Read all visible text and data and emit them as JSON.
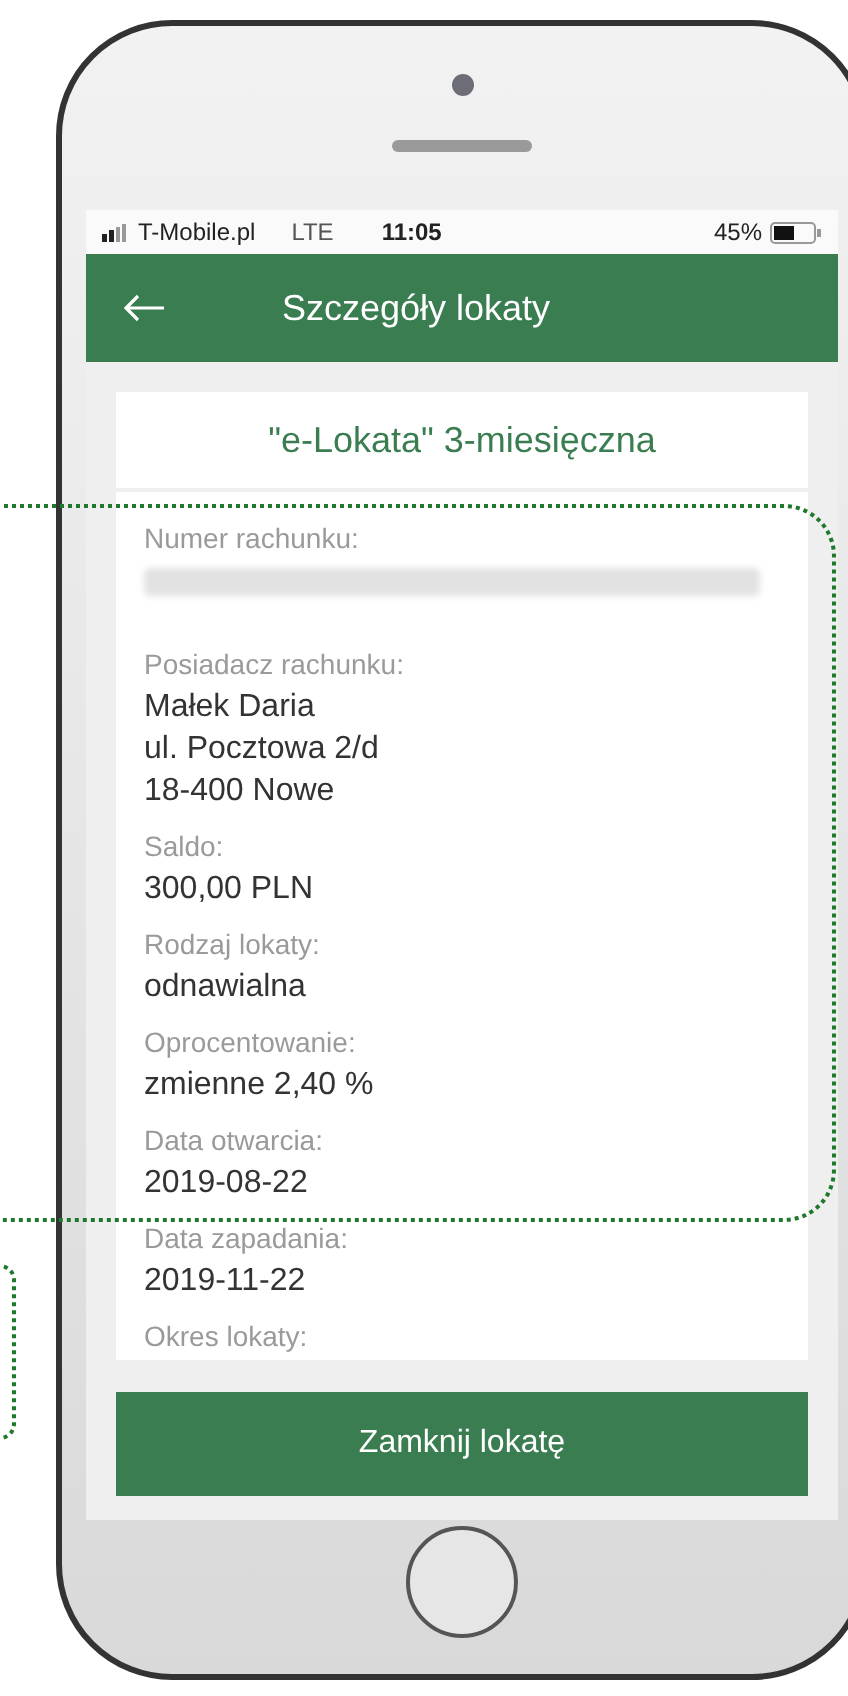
{
  "status_bar": {
    "carrier": "T-Mobile.pl",
    "network": "LTE",
    "time": "11:05",
    "battery": "45%"
  },
  "header": {
    "title": "Szczegóły lokaty"
  },
  "deposit_title": "\"e-Lokata\" 3-miesięczna",
  "fields": [
    {
      "kind": "masked",
      "label": "Numer rachunku:"
    },
    {
      "kind": "text",
      "label": "Posiadacz rachunku:",
      "lines": [
        "Małek Daria",
        "ul. Pocztowa 2/d",
        "18-400 Nowe"
      ]
    },
    {
      "kind": "text",
      "label": "Saldo:",
      "lines": [
        "300,00 PLN"
      ]
    },
    {
      "kind": "text",
      "label": "Rodzaj lokaty:",
      "lines": [
        "odnawialna"
      ]
    },
    {
      "kind": "text",
      "label": "Oprocentowanie:",
      "lines": [
        "zmienne 2,40 %"
      ]
    },
    {
      "kind": "text",
      "label": "Data otwarcia:",
      "lines": [
        "2019-08-22"
      ]
    },
    {
      "kind": "text",
      "label": "Data zapadania:",
      "lines": [
        "2019-11-22"
      ]
    },
    {
      "kind": "text",
      "label": "Okres lokaty:"
    }
  ],
  "action_button": "Zamknij lokatę"
}
